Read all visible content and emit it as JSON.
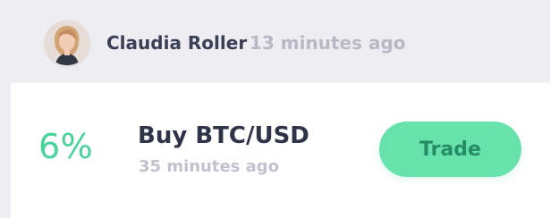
{
  "post": {
    "author": "Claudia Roller",
    "time": "13 minutes ago"
  },
  "trade": {
    "percent": "6%",
    "title": "Buy BTC/USD",
    "time": "35 minutes ago",
    "button_label": "Trade"
  },
  "colors": {
    "accent": "#48d39a",
    "button": "#68e2ab",
    "button_text": "#268c64",
    "header_bg": "#ededf2",
    "author_text": "#3b4056",
    "muted_text": "#b7b9c5"
  },
  "icons": {
    "avatar": "user-avatar-photo"
  }
}
